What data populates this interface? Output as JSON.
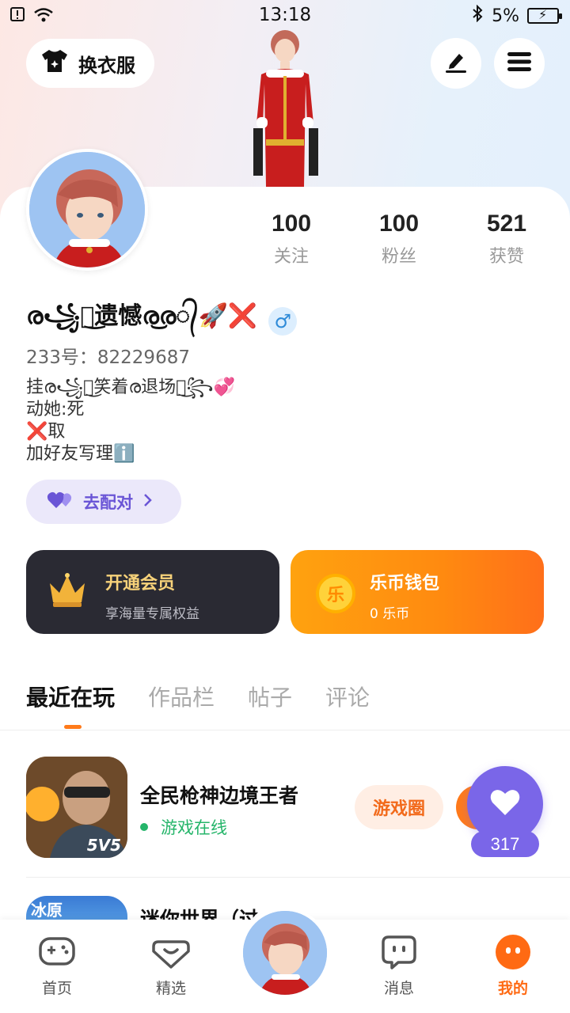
{
  "status_bar": {
    "time": "13:18",
    "battery": "5%",
    "icons": [
      "notification-icon",
      "wifi-icon",
      "bluetooth-icon",
      "battery-charging-icon"
    ]
  },
  "header": {
    "outfit_label": "换衣服",
    "edit_icon": "pen-icon",
    "menu_icon": "menu-icon"
  },
  "profile": {
    "stats": [
      {
        "value": "100",
        "label": "关注"
      },
      {
        "value": "100",
        "label": "粉丝"
      },
      {
        "value": "521",
        "label": "获赞"
      }
    ],
    "username": "ര꧁꫶͜遗憾ര͜ര᭄🚀❌",
    "gender": "♂",
    "uid": "233号：82229687",
    "bio": [
      "挂ര꧁꫶͜笑着ര退场꫶͜꧂💞",
      "动她:死",
      "❌取",
      "加好友写理ℹ️"
    ],
    "match_label": "去配对"
  },
  "promo": {
    "vip": {
      "title": "开通会员",
      "subtitle": "享海量专属权益"
    },
    "wallet": {
      "title": "乐币钱包",
      "subtitle": "0 乐币",
      "coin_glyph": "乐"
    }
  },
  "tabs": [
    "最近在玩",
    "作品栏",
    "帖子",
    "评论"
  ],
  "games": [
    {
      "title": "全民枪神边境王者",
      "status": "游戏在线",
      "circle_label": "游戏圈",
      "icon_text": "5V5"
    },
    {
      "title": "迷你世界（过",
      "icon_text": "冰原"
    }
  ],
  "like_fab": {
    "count": "317"
  },
  "bottom_nav": [
    {
      "label": "首页",
      "icon": "gamepad-icon"
    },
    {
      "label": "精选",
      "icon": "heart-box-icon"
    },
    {
      "label": "",
      "icon": "avatar"
    },
    {
      "label": "消息",
      "icon": "chat-icon"
    },
    {
      "label": "我的",
      "icon": "profile-face-icon"
    }
  ],
  "colors": {
    "accent": "#ff7a1a",
    "purple": "#7a66e8",
    "online_green": "#25b56a",
    "vip_bg": "#2a2a33"
  }
}
